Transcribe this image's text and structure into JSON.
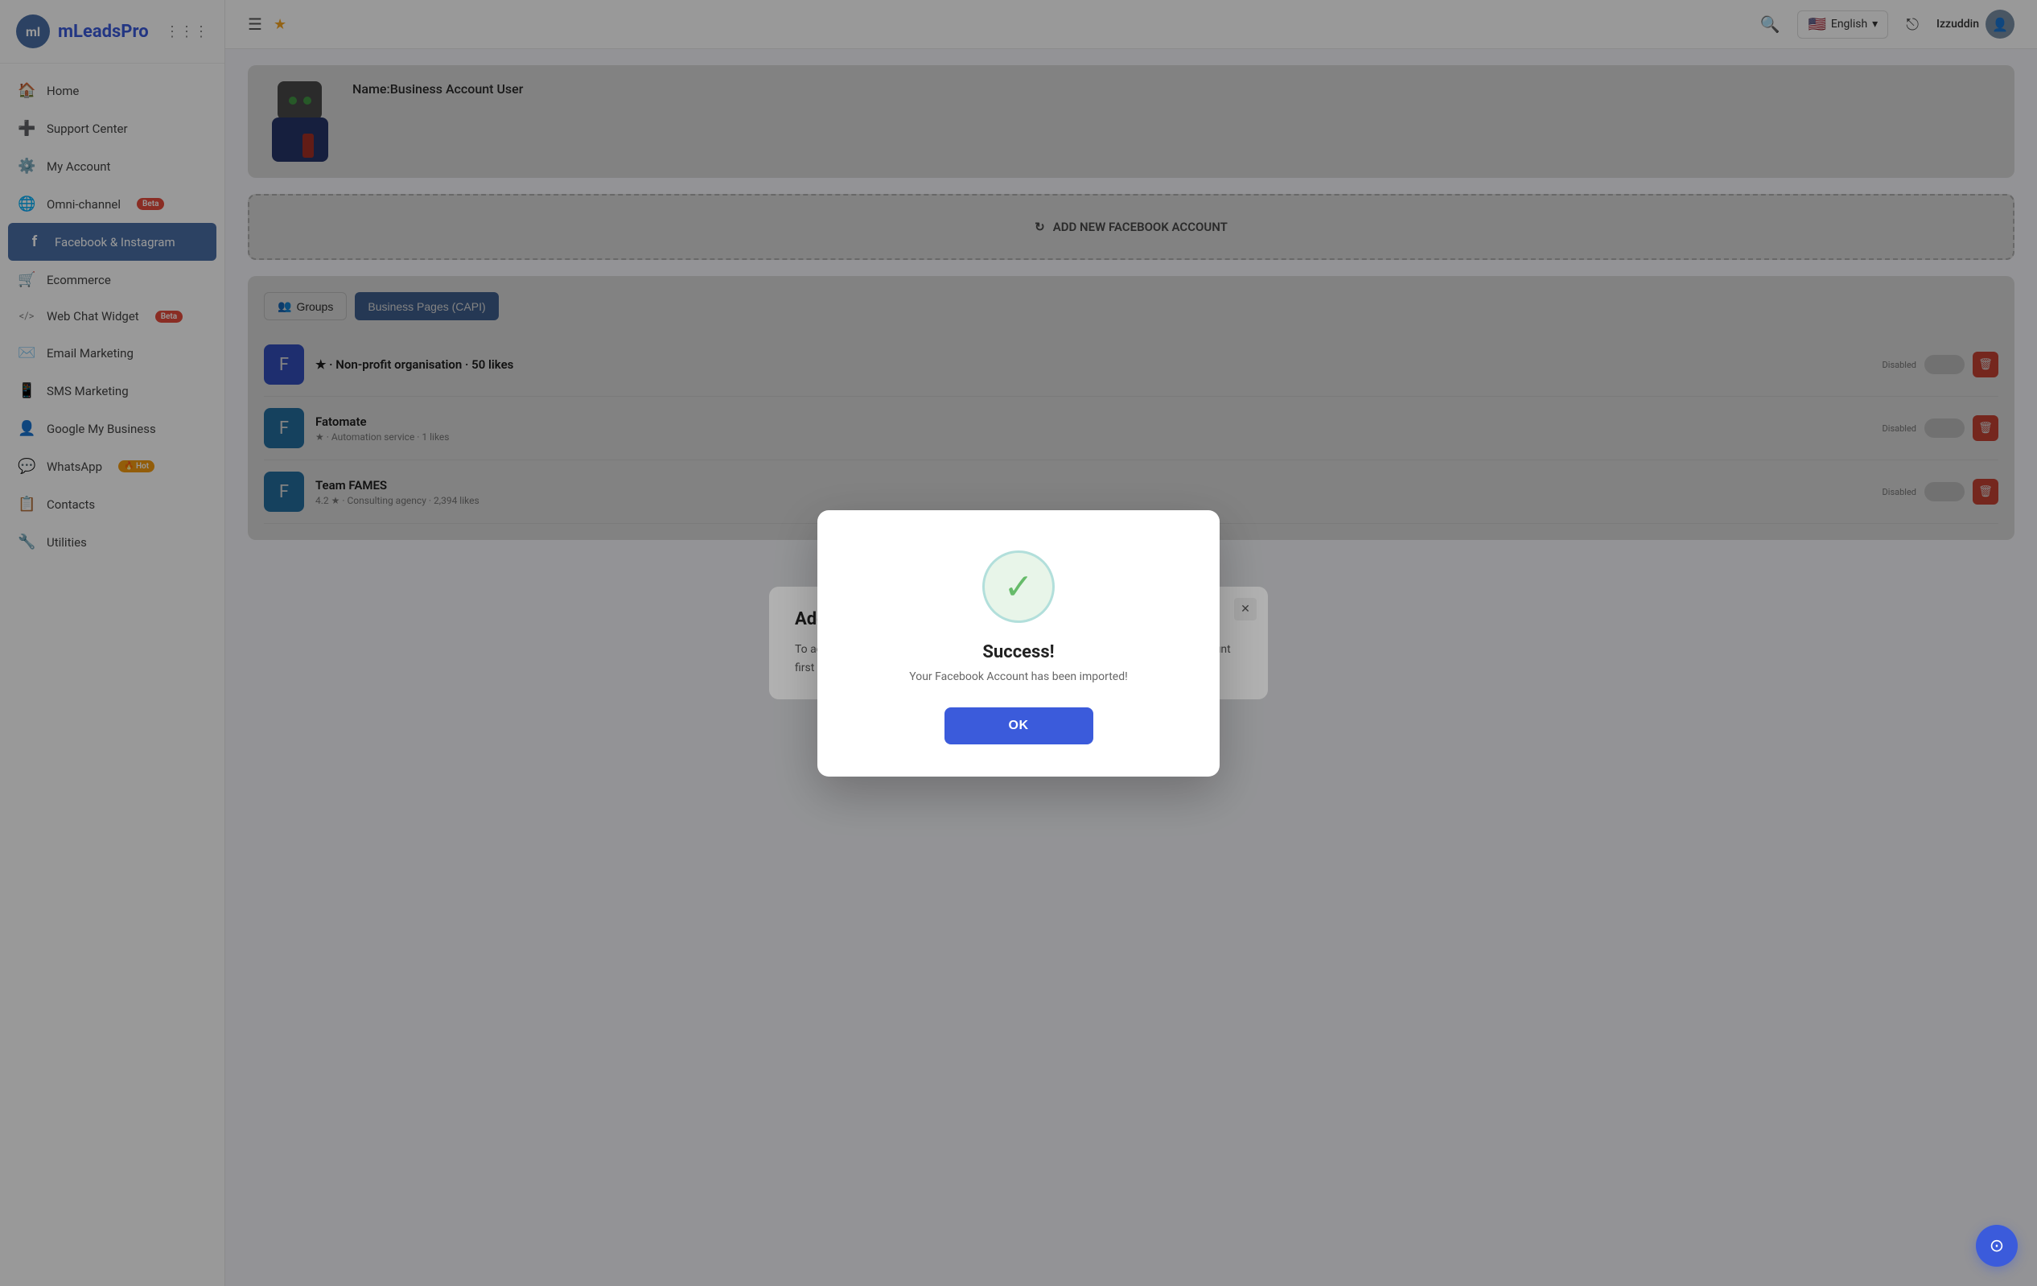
{
  "app": {
    "name": "mLeadsPro",
    "logo_text": "ml"
  },
  "sidebar": {
    "items": [
      {
        "id": "home",
        "label": "Home",
        "icon": "🏠",
        "active": false
      },
      {
        "id": "support",
        "label": "Support Center",
        "icon": "➕",
        "active": false
      },
      {
        "id": "account",
        "label": "My Account",
        "icon": "⚙️",
        "active": false
      },
      {
        "id": "omnichannel",
        "label": "Omni-channel",
        "icon": "🌐",
        "active": false,
        "badge": "Beta",
        "badge_type": "beta"
      },
      {
        "id": "facebook",
        "label": "Facebook & Instagram",
        "icon": "f",
        "active": true
      },
      {
        "id": "ecommerce",
        "label": "Ecommerce",
        "icon": "🛒",
        "active": false
      },
      {
        "id": "webchat",
        "label": "Web Chat Widget",
        "icon": "</>",
        "active": false,
        "badge": "Beta",
        "badge_type": "beta"
      },
      {
        "id": "email",
        "label": "Email Marketing",
        "icon": "✉️",
        "active": false
      },
      {
        "id": "sms",
        "label": "SMS Marketing",
        "icon": "📱",
        "active": false
      },
      {
        "id": "gmb",
        "label": "Google My Business",
        "icon": "👤",
        "active": false
      },
      {
        "id": "whatsapp",
        "label": "WhatsApp",
        "icon": "💬",
        "active": false,
        "badge": "🔥 Hot",
        "badge_type": "hot"
      },
      {
        "id": "contacts",
        "label": "Contacts",
        "icon": "📋",
        "active": false
      },
      {
        "id": "utilities",
        "label": "Utilities",
        "icon": "🔧",
        "active": false
      }
    ]
  },
  "topbar": {
    "search_icon": "search",
    "language": "English",
    "flag": "🇺🇸",
    "user_name": "Izzuddin",
    "logout_icon": "logout"
  },
  "account_card": {
    "name_label": "Name:",
    "name_value": "Business Account User"
  },
  "add_facebook": {
    "label": "ADD NEW FACEBOOK ACCOUNT",
    "icon": "↻"
  },
  "pages": {
    "groups_btn": "Groups",
    "capi_btn": "Business Pages (CAPI)",
    "items": [
      {
        "name": "Non-profit organisation",
        "rating": "★",
        "type": "Non-profit organisation",
        "likes": "50 likes",
        "status": "Disabled"
      },
      {
        "name": "Fatomate",
        "rating": "★",
        "type": "Automation service",
        "likes": "1 likes",
        "status": "Disabled"
      },
      {
        "name": "Team FAMES",
        "rating": "4.2 ★",
        "type": "Consulting agency",
        "likes": "2,394 likes",
        "status": "Disabled"
      }
    ]
  },
  "add_fb_modal": {
    "title": "Add A New Facebook Page",
    "description": "To add a new Facebook page, click the button below to connect your Facebook account first - after that you will be shown your pages list.",
    "close_label": "✕"
  },
  "success_modal": {
    "title": "Success!",
    "message": "Your Facebook Account has been imported!",
    "ok_label": "OK",
    "check": "✓"
  },
  "support_fab": {
    "icon": "⊙"
  }
}
